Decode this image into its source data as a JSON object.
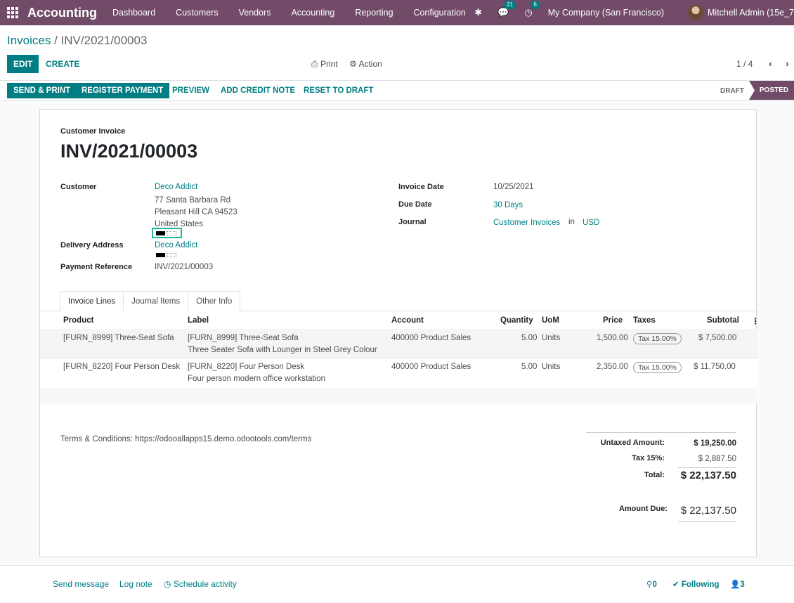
{
  "navbar": {
    "app_name": "Accounting",
    "menu": [
      "Dashboard",
      "Customers",
      "Vendors",
      "Accounting",
      "Reporting",
      "Configuration"
    ],
    "chat_count": "21",
    "activity_count": "6",
    "company": "My Company (San Francisco)",
    "user": "Mitchell Admin (15e_7"
  },
  "control": {
    "breadcrumb_parent": "Invoices",
    "breadcrumb_sep": " / ",
    "breadcrumb_current": "INV/2021/00003",
    "edit": "EDIT",
    "create": "CREATE",
    "print": "Print",
    "action": "Action",
    "pager": "1 / 4"
  },
  "statusbar": {
    "send_print": "SEND & PRINT",
    "register_payment": "REGISTER PAYMENT",
    "preview": "PREVIEW",
    "add_credit_note": "ADD CREDIT NOTE",
    "reset_to_draft": "RESET TO DRAFT",
    "stage_draft": "DRAFT",
    "stage_posted": "POSTED"
  },
  "invoice": {
    "type": "Customer Invoice",
    "number": "INV/2021/00003",
    "customer_label": "Customer",
    "customer_name": "Deco Addict",
    "address": [
      "77 Santa Barbara Rd",
      "Pleasant Hill CA 94523",
      "United States"
    ],
    "delivery_label": "Delivery Address",
    "delivery_name": "Deco Addict",
    "payref_label": "Payment Reference",
    "payref_value": "INV/2021/00003",
    "invoice_date_label": "Invoice Date",
    "invoice_date": "10/25/2021",
    "due_date_label": "Due Date",
    "due_date": "30 Days",
    "journal_label": "Journal",
    "journal": "Customer Invoices",
    "journal_in": "in",
    "currency": "USD"
  },
  "tabs": [
    "Invoice Lines",
    "Journal Items",
    "Other Info"
  ],
  "table": {
    "headers": [
      "Product",
      "Label",
      "Account",
      "Quantity",
      "UoM",
      "Price",
      "Taxes",
      "Subtotal"
    ],
    "rows": [
      {
        "product": "[FURN_8999] Three-Seat Sofa",
        "label1": "[FURN_8999] Three-Seat Sofa",
        "label2": "Three Seater Sofa with Lounger in Steel Grey Colour",
        "account": "400000 Product Sales",
        "quantity": "5.00",
        "uom": "Units",
        "price": "1,500.00",
        "tax": "Tax 15.00%",
        "subtotal": "$ 7,500.00"
      },
      {
        "product": "[FURN_8220] Four Person Desk",
        "label1": "[FURN_8220] Four Person Desk",
        "label2": "Four person modern office workstation",
        "account": "400000 Product Sales",
        "quantity": "5.00",
        "uom": "Units",
        "price": "2,350.00",
        "tax": "Tax 15.00%",
        "subtotal": "$ 11,750.00"
      }
    ]
  },
  "terms": "Terms & Conditions: https://odooallapps15.demo.odootools.com/terms",
  "totals": {
    "untaxed_label": "Untaxed Amount:",
    "untaxed": "$ 19,250.00",
    "tax_label": "Tax 15%:",
    "tax": "$ 2,887.50",
    "total_label": "Total:",
    "total": "$ 22,137.50",
    "due_label": "Amount Due:",
    "due": "$ 22,137.50"
  },
  "chatter": {
    "send_message": "Send message",
    "log_note": "Log note",
    "schedule_activity": "Schedule activity",
    "attachments": "0",
    "following": "Following",
    "followers": "3"
  }
}
